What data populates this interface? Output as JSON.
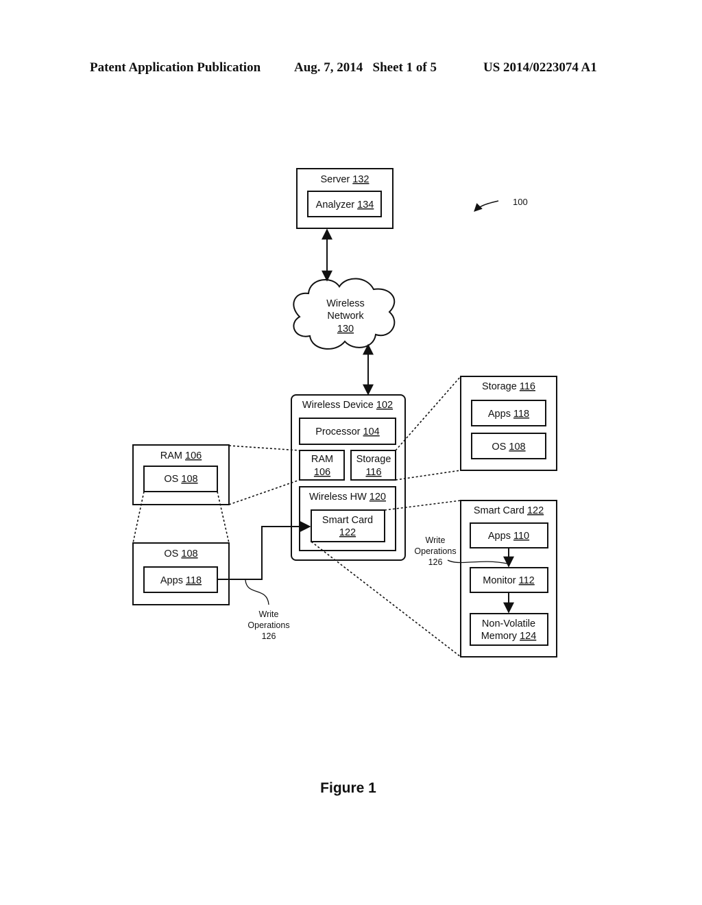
{
  "header": {
    "publication": "Patent Application Publication",
    "date_sheet": "Aug. 7, 2014   Sheet 1 of 5",
    "number": "US 2014/0223074 A1"
  },
  "figure_ref": "100",
  "figure_caption": "Figure 1",
  "server": {
    "name": "Server",
    "ref": "132",
    "analyzer": {
      "name": "Analyzer",
      "ref": "134"
    }
  },
  "network": {
    "line1": "Wireless",
    "line2": "Network",
    "ref": "130"
  },
  "device": {
    "name": "Wireless Device",
    "ref": "102",
    "processor": {
      "name": "Processor",
      "ref": "104"
    },
    "ram": {
      "name": "RAM",
      "ref": "106"
    },
    "storage": {
      "name": "Storage",
      "ref": "116"
    },
    "wireless_hw": {
      "name": "Wireless HW",
      "ref": "120"
    },
    "smart_card": {
      "name": "Smart Card",
      "ref": "122"
    }
  },
  "ram_detail": {
    "name": "RAM",
    "ref": "106",
    "os": {
      "name": "OS",
      "ref": "108"
    }
  },
  "os_detail": {
    "name": "OS",
    "ref": "108",
    "apps": {
      "name": "Apps",
      "ref": "118"
    }
  },
  "storage_detail": {
    "name": "Storage",
    "ref": "116",
    "apps": {
      "name": "Apps",
      "ref": "118"
    },
    "os": {
      "name": "OS",
      "ref": "108"
    }
  },
  "smartcard_detail": {
    "name": "Smart Card",
    "ref": "122",
    "apps": {
      "name": "Apps",
      "ref": "110"
    },
    "monitor": {
      "name": "Monitor",
      "ref": "112"
    },
    "nvm": {
      "line1": "Non-Volatile",
      "line2": "Memory",
      "ref": "124"
    }
  },
  "write_ops": {
    "line1": "Write",
    "line2": "Operations",
    "ref": "126"
  }
}
